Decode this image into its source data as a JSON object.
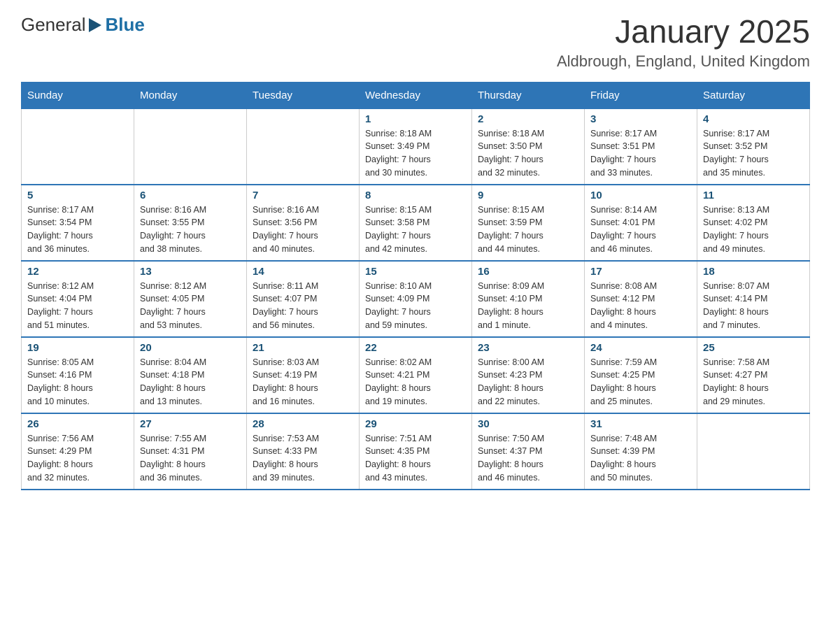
{
  "header": {
    "logo_general": "General",
    "logo_blue": "Blue",
    "month_title": "January 2025",
    "location": "Aldbrough, England, United Kingdom"
  },
  "days_of_week": [
    "Sunday",
    "Monday",
    "Tuesday",
    "Wednesday",
    "Thursday",
    "Friday",
    "Saturday"
  ],
  "weeks": [
    [
      {
        "day": "",
        "info": ""
      },
      {
        "day": "",
        "info": ""
      },
      {
        "day": "",
        "info": ""
      },
      {
        "day": "1",
        "info": "Sunrise: 8:18 AM\nSunset: 3:49 PM\nDaylight: 7 hours\nand 30 minutes."
      },
      {
        "day": "2",
        "info": "Sunrise: 8:18 AM\nSunset: 3:50 PM\nDaylight: 7 hours\nand 32 minutes."
      },
      {
        "day": "3",
        "info": "Sunrise: 8:17 AM\nSunset: 3:51 PM\nDaylight: 7 hours\nand 33 minutes."
      },
      {
        "day": "4",
        "info": "Sunrise: 8:17 AM\nSunset: 3:52 PM\nDaylight: 7 hours\nand 35 minutes."
      }
    ],
    [
      {
        "day": "5",
        "info": "Sunrise: 8:17 AM\nSunset: 3:54 PM\nDaylight: 7 hours\nand 36 minutes."
      },
      {
        "day": "6",
        "info": "Sunrise: 8:16 AM\nSunset: 3:55 PM\nDaylight: 7 hours\nand 38 minutes."
      },
      {
        "day": "7",
        "info": "Sunrise: 8:16 AM\nSunset: 3:56 PM\nDaylight: 7 hours\nand 40 minutes."
      },
      {
        "day": "8",
        "info": "Sunrise: 8:15 AM\nSunset: 3:58 PM\nDaylight: 7 hours\nand 42 minutes."
      },
      {
        "day": "9",
        "info": "Sunrise: 8:15 AM\nSunset: 3:59 PM\nDaylight: 7 hours\nand 44 minutes."
      },
      {
        "day": "10",
        "info": "Sunrise: 8:14 AM\nSunset: 4:01 PM\nDaylight: 7 hours\nand 46 minutes."
      },
      {
        "day": "11",
        "info": "Sunrise: 8:13 AM\nSunset: 4:02 PM\nDaylight: 7 hours\nand 49 minutes."
      }
    ],
    [
      {
        "day": "12",
        "info": "Sunrise: 8:12 AM\nSunset: 4:04 PM\nDaylight: 7 hours\nand 51 minutes."
      },
      {
        "day": "13",
        "info": "Sunrise: 8:12 AM\nSunset: 4:05 PM\nDaylight: 7 hours\nand 53 minutes."
      },
      {
        "day": "14",
        "info": "Sunrise: 8:11 AM\nSunset: 4:07 PM\nDaylight: 7 hours\nand 56 minutes."
      },
      {
        "day": "15",
        "info": "Sunrise: 8:10 AM\nSunset: 4:09 PM\nDaylight: 7 hours\nand 59 minutes."
      },
      {
        "day": "16",
        "info": "Sunrise: 8:09 AM\nSunset: 4:10 PM\nDaylight: 8 hours\nand 1 minute."
      },
      {
        "day": "17",
        "info": "Sunrise: 8:08 AM\nSunset: 4:12 PM\nDaylight: 8 hours\nand 4 minutes."
      },
      {
        "day": "18",
        "info": "Sunrise: 8:07 AM\nSunset: 4:14 PM\nDaylight: 8 hours\nand 7 minutes."
      }
    ],
    [
      {
        "day": "19",
        "info": "Sunrise: 8:05 AM\nSunset: 4:16 PM\nDaylight: 8 hours\nand 10 minutes."
      },
      {
        "day": "20",
        "info": "Sunrise: 8:04 AM\nSunset: 4:18 PM\nDaylight: 8 hours\nand 13 minutes."
      },
      {
        "day": "21",
        "info": "Sunrise: 8:03 AM\nSunset: 4:19 PM\nDaylight: 8 hours\nand 16 minutes."
      },
      {
        "day": "22",
        "info": "Sunrise: 8:02 AM\nSunset: 4:21 PM\nDaylight: 8 hours\nand 19 minutes."
      },
      {
        "day": "23",
        "info": "Sunrise: 8:00 AM\nSunset: 4:23 PM\nDaylight: 8 hours\nand 22 minutes."
      },
      {
        "day": "24",
        "info": "Sunrise: 7:59 AM\nSunset: 4:25 PM\nDaylight: 8 hours\nand 25 minutes."
      },
      {
        "day": "25",
        "info": "Sunrise: 7:58 AM\nSunset: 4:27 PM\nDaylight: 8 hours\nand 29 minutes."
      }
    ],
    [
      {
        "day": "26",
        "info": "Sunrise: 7:56 AM\nSunset: 4:29 PM\nDaylight: 8 hours\nand 32 minutes."
      },
      {
        "day": "27",
        "info": "Sunrise: 7:55 AM\nSunset: 4:31 PM\nDaylight: 8 hours\nand 36 minutes."
      },
      {
        "day": "28",
        "info": "Sunrise: 7:53 AM\nSunset: 4:33 PM\nDaylight: 8 hours\nand 39 minutes."
      },
      {
        "day": "29",
        "info": "Sunrise: 7:51 AM\nSunset: 4:35 PM\nDaylight: 8 hours\nand 43 minutes."
      },
      {
        "day": "30",
        "info": "Sunrise: 7:50 AM\nSunset: 4:37 PM\nDaylight: 8 hours\nand 46 minutes."
      },
      {
        "day": "31",
        "info": "Sunrise: 7:48 AM\nSunset: 4:39 PM\nDaylight: 8 hours\nand 50 minutes."
      },
      {
        "day": "",
        "info": ""
      }
    ]
  ]
}
